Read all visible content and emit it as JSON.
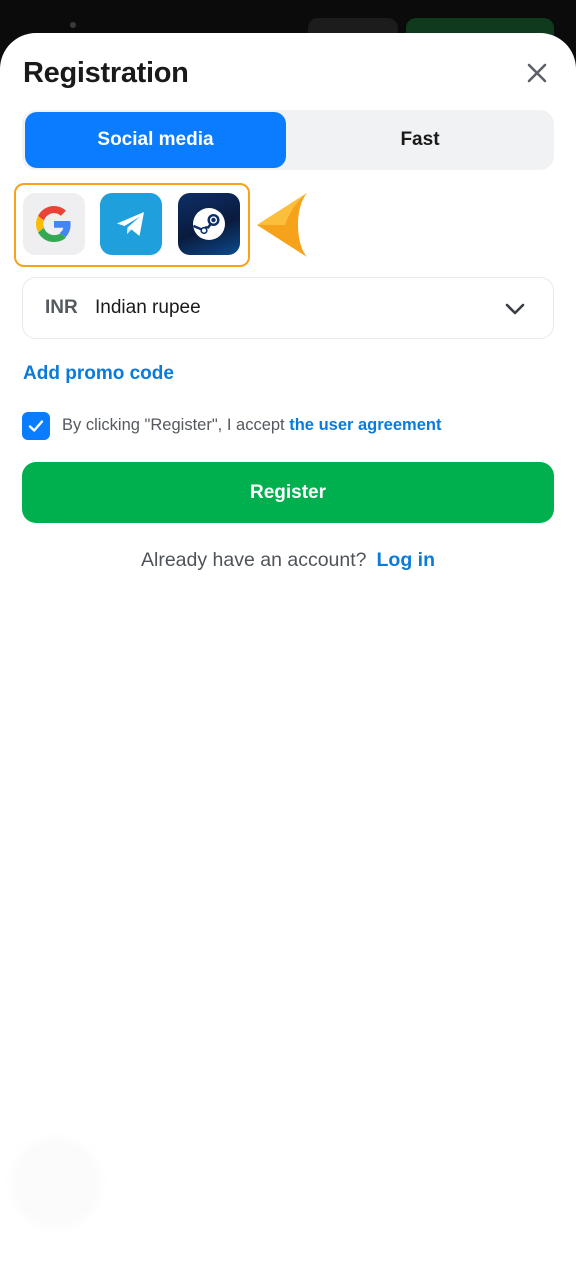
{
  "header": {
    "title": "Registration",
    "close_icon": "close-icon"
  },
  "tabs": [
    {
      "label": "Social media",
      "active": true
    },
    {
      "label": "Fast",
      "active": false
    }
  ],
  "social": {
    "providers": [
      {
        "name": "Google",
        "icon": "google-icon"
      },
      {
        "name": "Telegram",
        "icon": "telegram-icon"
      },
      {
        "name": "Steam",
        "icon": "steam-icon"
      }
    ],
    "highlight_color": "#f7a21b"
  },
  "currency": {
    "code": "INR",
    "name": "Indian rupee"
  },
  "promo": {
    "label": "Add promo code"
  },
  "agreement": {
    "checked": true,
    "text": "By clicking \"Register\", I accept",
    "link_text": "the user agreement"
  },
  "register": {
    "label": "Register"
  },
  "login": {
    "prompt": "Already have an account?",
    "link": "Log in"
  },
  "colors": {
    "accent": "#0a7cff",
    "link": "#0a7bd9",
    "register": "#00b04f"
  }
}
